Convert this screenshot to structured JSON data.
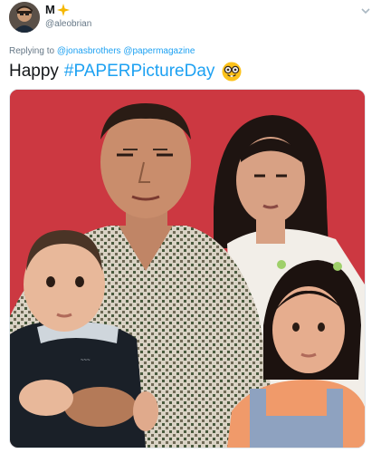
{
  "tweet": {
    "author": {
      "display_name": "M",
      "handle": "@aleobrian",
      "avatar_icon": "user-avatar"
    },
    "replying_to": {
      "prefix": "Replying to",
      "mentions": [
        "@jonasbrothers",
        "@papermagazine"
      ]
    },
    "text": {
      "word": "Happy",
      "hashtag": "#PAPERPictureDay",
      "emoji_icon": "nerd-face-emoji-icon"
    },
    "photo": {
      "description_icon": "family-portrait-photo",
      "background_color": "#cf3a44"
    }
  },
  "colors": {
    "link": "#1da1f2",
    "secondary_text": "#657786",
    "primary_text": "#14171a"
  }
}
